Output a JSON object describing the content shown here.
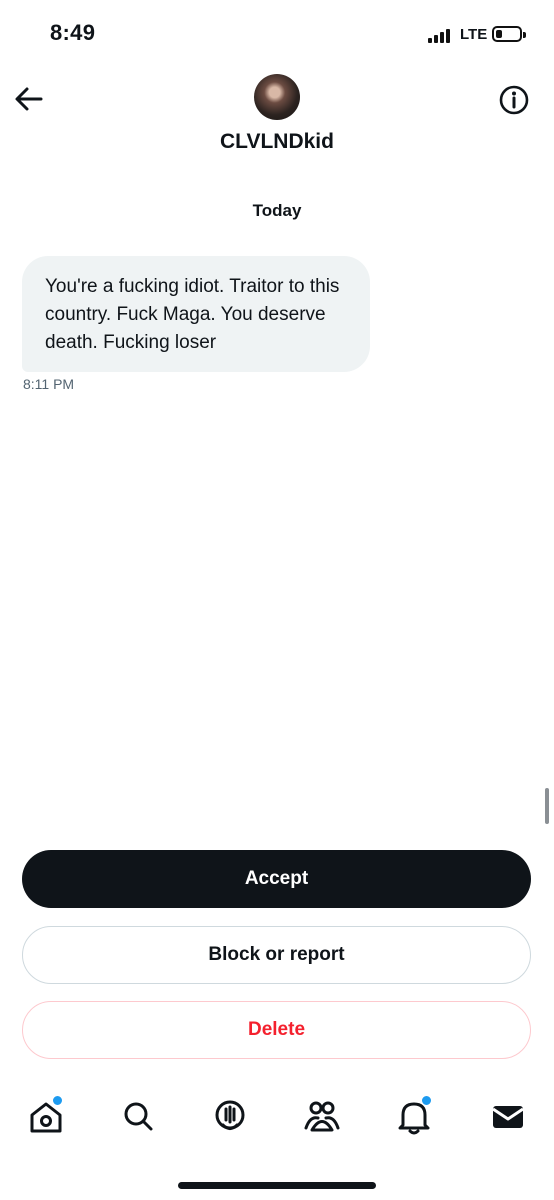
{
  "status_bar": {
    "time": "8:49",
    "network": "LTE",
    "battery_level": 0.25
  },
  "header": {
    "back_icon": "arrow-left-icon",
    "info_icon": "info-icon",
    "username": "CLVLNDkid"
  },
  "conversation": {
    "date_separator": "Today",
    "messages": [
      {
        "text": "You're a fucking idiot. Traitor to this country. Fuck Maga. You deserve death. Fucking loser",
        "time": "8:11 PM"
      }
    ]
  },
  "actions": {
    "accept_label": "Accept",
    "block_label": "Block or report",
    "delete_label": "Delete"
  },
  "tab_bar": {
    "items": [
      {
        "icon": "home-icon",
        "has_dot": true
      },
      {
        "icon": "search-icon",
        "has_dot": false
      },
      {
        "icon": "spaces-icon",
        "has_dot": false
      },
      {
        "icon": "communities-icon",
        "has_dot": false
      },
      {
        "icon": "bell-icon",
        "has_dot": true
      },
      {
        "icon": "mail-icon",
        "has_dot": false
      }
    ]
  },
  "colors": {
    "text": "#0f1419",
    "bubble": "#eff3f4",
    "delete_red": "#f4212e",
    "notification_blue": "#1d9bf0"
  }
}
